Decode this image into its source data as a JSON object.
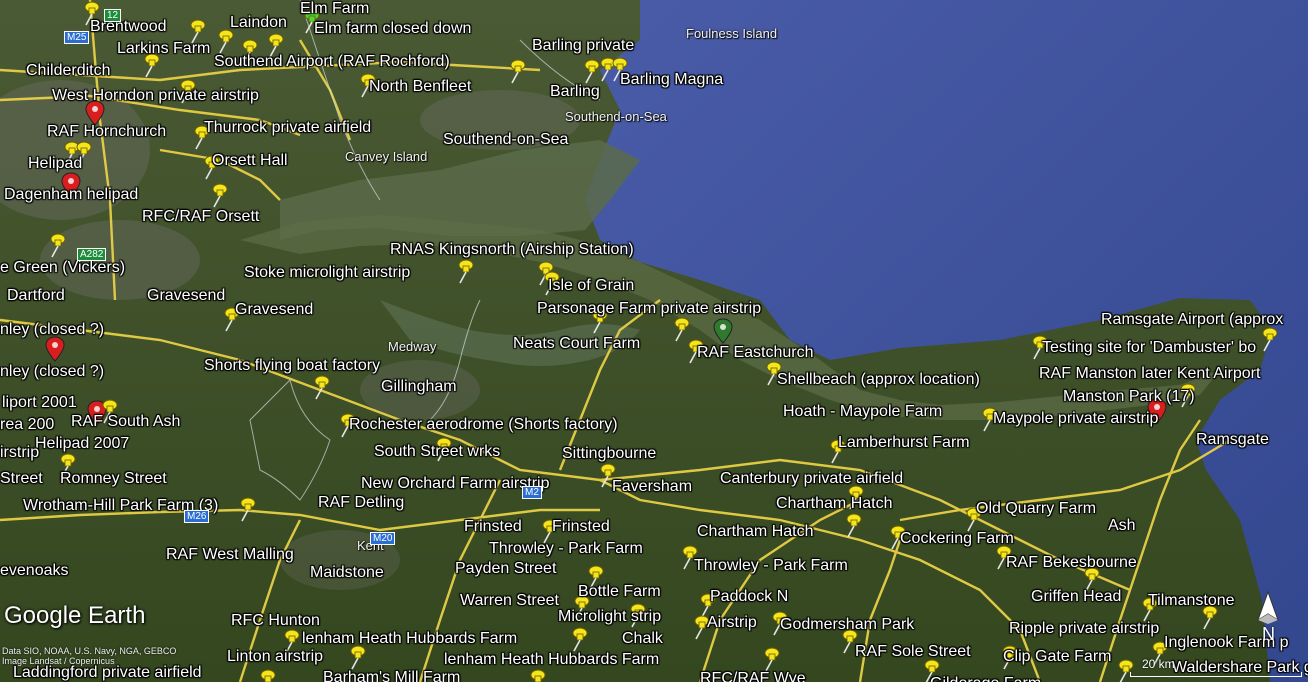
{
  "map": {
    "app_logo": "Google Earth",
    "credit": "Data SIO, NOAA, U.S. Navy, NGA, GEBCO",
    "image_credit": "Image Landsat / Copernicus",
    "scale_label": "20 km",
    "compass_letter": "N",
    "colors": {
      "sea": "#3c4f9c",
      "land": "#3e5229",
      "label": "#ffffff",
      "pin": "#f5e51c",
      "road": "#e9d44a"
    },
    "labels": [
      "Brentwood",
      "Laindon",
      "Elm Farm",
      "Elm farm closed down",
      "Larkins Farm",
      "Childerditch",
      "Southend Airport (RAF Rochford)",
      "Barling private",
      "Barling Magna",
      "Barling",
      "North Benfleet",
      "West Horndon private airstrip",
      "RAF Hornchurch",
      "Thurrock private airfield",
      "Southend-on-Sea",
      "Helipad",
      "Orsett Hall",
      "Dagenham helipad",
      "RFC/RAF Orsett",
      "RNAS Kingsnorth (Airship Station)",
      "e Green (Vickers)",
      "Stoke microlight airstrip",
      "Isle of Grain",
      "Dartford",
      "Gravesend",
      "Gravesend",
      "Parsonage Farm private airstrip",
      "Ramsgate Airport  (approx",
      "nley (closed ?)",
      "Neats Court Farm",
      "RAF Eastchurch",
      "Testing site for 'Dambuster' bo",
      "Shorts flying boat factory",
      "nley (closed ?)",
      "Shellbeach (approx location)",
      "RAF Manston later Kent Airport",
      "Gillingham",
      "Manston Park (17)",
      "Hoath - Maypole Farm",
      "Maypole private airstrip",
      "liport 2001",
      "RAF South Ash",
      "Rochester aerodrome (Shorts factory)",
      "Ramsgate",
      "rea 200",
      "Lamberhurst Farm",
      "Helipad 2007",
      "irstrip",
      "South Street  wrks",
      "Sittingbourne",
      "Street",
      "Romney Street",
      "Canterbury private airfield",
      "New Orchard Farm airstrip",
      "Faversham",
      "Wrotham-Hill Park Farm (3)",
      "RAF Detling",
      "Chartham Hatch",
      "Old Quarry Farm",
      "Frinsted",
      "Frinsted",
      "Ash",
      "Chartham Hatch",
      "Throwley - Park Farm",
      "Cockering Farm",
      "RAF West Malling",
      "RAF Bekesbourne",
      "Payden Street",
      "Throwley - Park Farm",
      "Maidstone",
      "evenoaks",
      "Bottle Farm",
      "Griffen Head",
      "Warren Street",
      "Paddock N",
      "Tilmanstone",
      "Microlight strip",
      "Airstrip",
      "RFC Hunton",
      "Godmersham Park",
      "Ripple private airstrip",
      "Chalk",
      "lenham Heath Hubbards Farm",
      "Inglenook Farm p",
      "RAF Sole Street",
      "Clip Gate Farm",
      "Linton airstrip",
      "lenham Heath Hubbards Farm",
      "Waldershare Park gli",
      "Laddingford private airfield",
      "Barham's Mill Farm",
      "RFC/RAF Wye",
      "Gilderage Farm"
    ],
    "places": [
      "Foulness Island",
      "Southend-on-Sea",
      "Canvey Island",
      "Medway",
      "Kent"
    ],
    "roads": [
      {
        "label": "M25",
        "style": "blue"
      },
      {
        "label": "12",
        "style": "green"
      },
      {
        "label": "A282",
        "style": "green"
      },
      {
        "label": "M26",
        "style": "blue"
      },
      {
        "label": "M20",
        "style": "blue"
      },
      {
        "label": "M2",
        "style": "blue"
      }
    ]
  }
}
